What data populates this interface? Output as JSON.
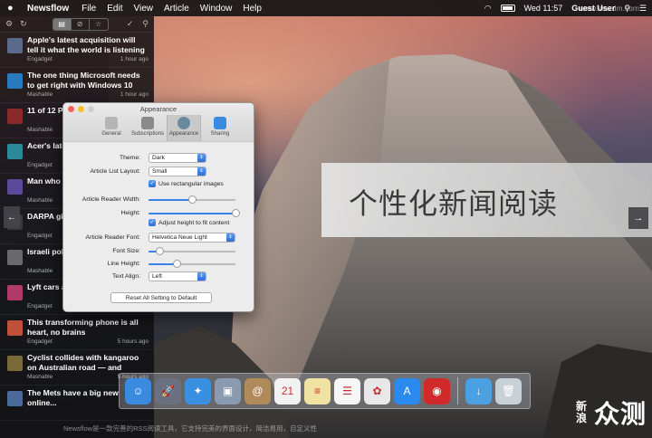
{
  "menubar": {
    "app": "Newsflow",
    "items": [
      "File",
      "Edit",
      "View",
      "Article",
      "Window",
      "Help"
    ],
    "clock": "Wed 11:57",
    "user": "Guest User",
    "watermark": "www.smzdm.com"
  },
  "sidebar": {
    "articles": [
      {
        "title": "Apple's latest acquisition will tell it what the world is listening to",
        "source": "Engadget",
        "time": "1 hour ago",
        "color": "#5a6a8a"
      },
      {
        "title": "The one thing Microsoft needs to get right with Windows 10",
        "source": "Mashable",
        "time": "1 hour ago",
        "color": "#2a7abf"
      },
      {
        "title": "11 of 12 Pa... under-infla...",
        "source": "Mashable",
        "time": "",
        "color": "#8a2a2a"
      },
      {
        "title": "Acer's lates... built to sur...",
        "source": "Engadget",
        "time": "",
        "color": "#2a8a9a"
      },
      {
        "title": "Man who c... grocery ge...",
        "source": "Mashable",
        "time": "",
        "color": "#5a4a9a"
      },
      {
        "title": "DARPA giv... makeover,...",
        "source": "Engadget",
        "time": "",
        "color": "#3a3a3a"
      },
      {
        "title": "Israeli poli... passenger...",
        "source": "Mashable",
        "time": "",
        "color": "#6a6a6a"
      },
      {
        "title": "Lyft cars a... fuzzy mus...",
        "source": "Engadget",
        "time": "4 hours ago",
        "color": "#b03a6a"
      },
      {
        "title": "This transforming phone is all heart, no brains",
        "source": "Engadget",
        "time": "5 hours ago",
        "color": "#c0503a"
      },
      {
        "title": "Cyclist collides with kangaroo on Australian road — and catch...",
        "source": "Mashable",
        "time": "5 hours ago",
        "color": "#7a6a3a"
      },
      {
        "title": "The Mets have a big new online...",
        "source": "",
        "time": "",
        "color": "#4a6a9a"
      }
    ]
  },
  "prefs": {
    "title": "Appearance",
    "tabs": [
      "General",
      "Subscriptions",
      "Appearance",
      "Sharing"
    ],
    "theme_label": "Theme:",
    "theme_value": "Dark",
    "layout_label": "Article List Layout:",
    "layout_value": "Small",
    "rect_images": "Use rectangular images",
    "width_label": "Article Reader Width:",
    "width_level": 0.5,
    "height_label": "Height:",
    "height_level": 1.0,
    "adjust_height": "Adjust height to fit content",
    "font_label": "Article Reader Font:",
    "font_value": "Helvetica Neue Light",
    "fontsize_label": "Font Size:",
    "fontsize_level": 0.12,
    "lineheight_label": "Line Height:",
    "lineheight_level": 0.32,
    "align_label": "Text Align:",
    "align_value": "Left",
    "reset": "Reset All Setting to Default"
  },
  "banner": {
    "text": "个性化新闻阅读"
  },
  "dock": {
    "apps": [
      {
        "name": "finder",
        "color": "#3a8ae0",
        "glyph": "☺"
      },
      {
        "name": "launchpad",
        "color": "#6a7080",
        "glyph": "🚀"
      },
      {
        "name": "safari",
        "color": "#3a90e0",
        "glyph": "✦"
      },
      {
        "name": "preview",
        "color": "#8a9ab0",
        "glyph": "▣"
      },
      {
        "name": "contacts",
        "color": "#b08a5a",
        "glyph": "@"
      },
      {
        "name": "calendar",
        "color": "#f2f2f2",
        "glyph": "21"
      },
      {
        "name": "notes",
        "color": "#f0e2a0",
        "glyph": "≡"
      },
      {
        "name": "reminders",
        "color": "#f6f6f6",
        "glyph": "☰"
      },
      {
        "name": "photos",
        "color": "#e8e8e8",
        "glyph": "✿"
      },
      {
        "name": "app-store",
        "color": "#2a8af0",
        "glyph": "A"
      },
      {
        "name": "newsflow",
        "color": "#d02a2a",
        "glyph": "◉"
      },
      {
        "name": "downloads",
        "color": "#4aa0e0",
        "glyph": "↓"
      },
      {
        "name": "trash",
        "color": "#c8d0d8",
        "glyph": "🗑"
      }
    ]
  },
  "caption": "Newsflow是一款完善的RSS阅读工具，它支持完美的界面设计，简洁易用，自定义性",
  "watermark": {
    "small": "新浪",
    "big": "众测"
  }
}
